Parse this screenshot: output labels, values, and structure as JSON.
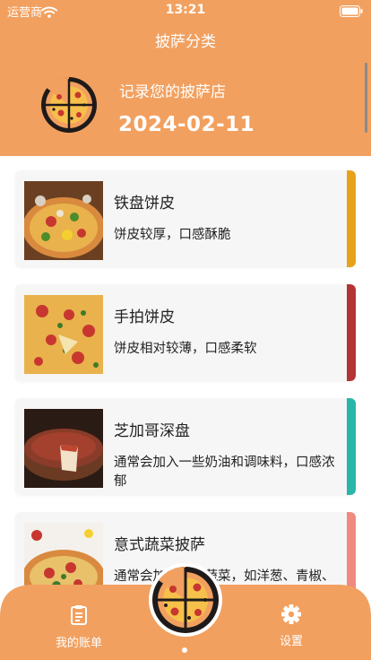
{
  "status_bar": {
    "carrier": "运营商",
    "time": "13:21"
  },
  "nav": {
    "title": "披萨分类"
  },
  "hero": {
    "subtitle": "记录您的披萨店",
    "date": "2024-02-11"
  },
  "categories": [
    {
      "title": "铁盘饼皮",
      "description": "饼皮较厚，口感酥脆",
      "accent_color": "#E7A21C"
    },
    {
      "title": "手拍饼皮",
      "description": "饼皮相对较薄，口感柔软",
      "accent_color": "#B43436"
    },
    {
      "title": "芝加哥深盘",
      "description": "通常会加入一些奶油和调味料，口感浓郁",
      "accent_color": "#2AB6A9"
    },
    {
      "title": "意式蔬菜披萨",
      "description": "通常会加入一些蔬菜，如洋葱、青椒、蘑菇等，口感清淡",
      "accent_color": "#F08A80"
    }
  ],
  "tabbar": {
    "left_label": "我的账单",
    "left_icon": "clipboard-icon",
    "right_label": "设置",
    "right_icon": "gear-icon",
    "center_icon": "pizza-logo-icon"
  },
  "colors": {
    "header": "#F2A05F",
    "tabbar": "#F2A05F",
    "card": "#F7F6F6"
  }
}
